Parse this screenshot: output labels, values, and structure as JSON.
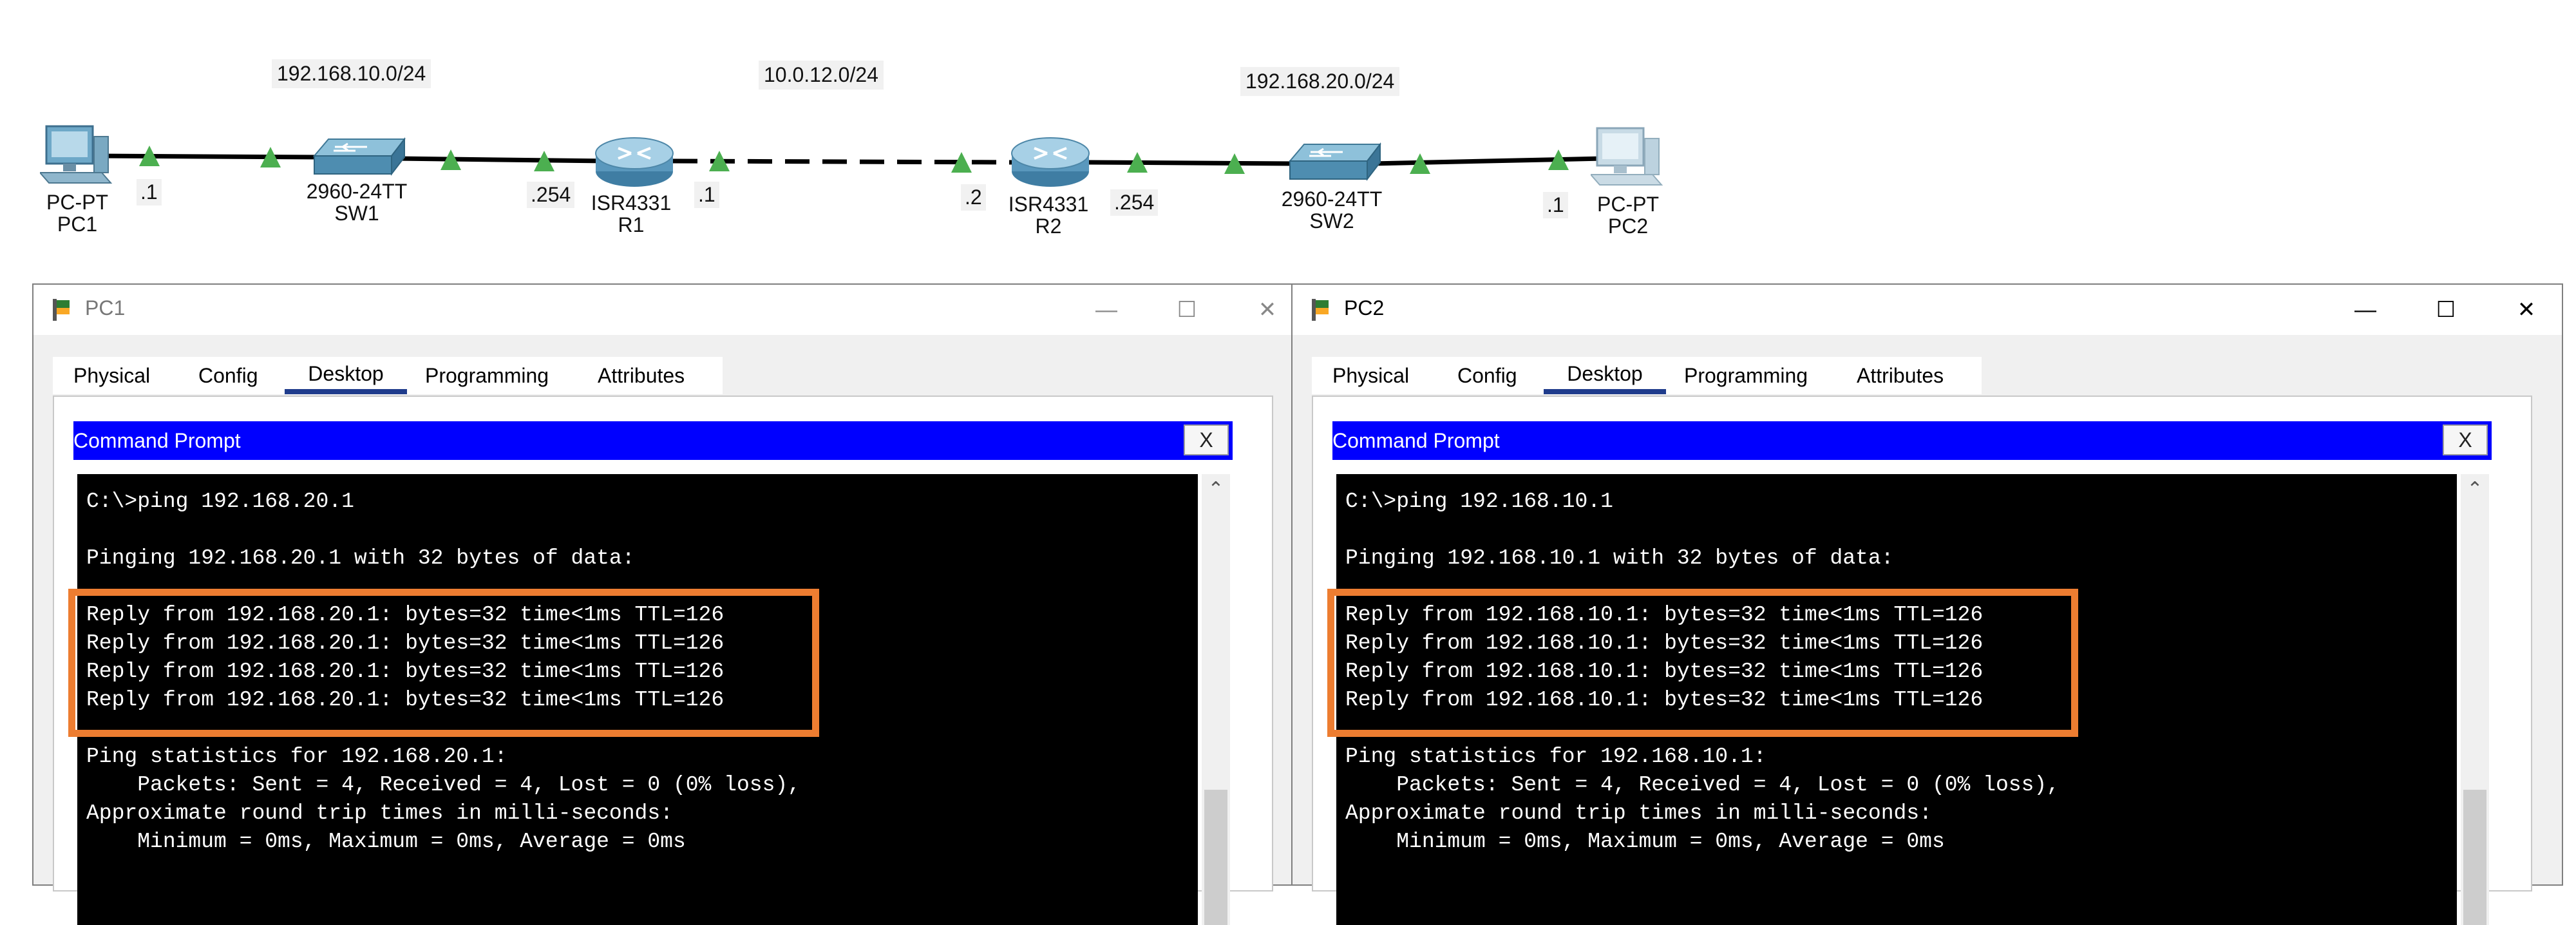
{
  "colors": {
    "accent_highlight": "#ed7d31",
    "command_prompt_bar": "#0000ff",
    "tab_underline": "#1f3c8c",
    "link_green": "#4caf50"
  },
  "topology": {
    "subnets": [
      "192.168.10.0/24",
      "10.0.12.0/24",
      "192.168.20.0/24"
    ],
    "interfaces": [
      ".1",
      ".254",
      ".1",
      ".2",
      ".254",
      ".1"
    ],
    "devices": [
      {
        "name": "PC1",
        "model": "PC-PT",
        "icon": "pc-icon"
      },
      {
        "name": "SW1",
        "model": "2960-24TT",
        "icon": "switch-icon"
      },
      {
        "name": "R1",
        "model": "ISR4331",
        "icon": "router-icon"
      },
      {
        "name": "R2",
        "model": "ISR4331",
        "icon": "router-icon"
      },
      {
        "name": "SW2",
        "model": "2960-24TT",
        "icon": "switch-icon"
      },
      {
        "name": "PC2",
        "model": "PC-PT",
        "icon": "pc-icon"
      }
    ]
  },
  "windows": [
    {
      "title": "PC1",
      "controls": [
        "—",
        "☐",
        "✕"
      ],
      "tabs": [
        "Physical",
        "Config",
        "Desktop",
        "Programming",
        "Attributes"
      ],
      "active_tab": "Desktop",
      "app_title": "Command Prompt",
      "app_close": "X",
      "lines": [
        "C:\\>ping 192.168.20.1",
        "Pinging 192.168.20.1 with 32 bytes of data:",
        "Reply from 192.168.20.1: bytes=32 time<1ms TTL=126",
        "Reply from 192.168.20.1: bytes=32 time<1ms TTL=126",
        "Reply from 192.168.20.1: bytes=32 time<1ms TTL=126",
        "Reply from 192.168.20.1: bytes=32 time<1ms TTL=126",
        "Ping statistics for 192.168.20.1:",
        "    Packets: Sent = 4, Received = 4, Lost = 0 (0% loss),",
        "Approximate round trip times in milli-seconds:",
        "    Minimum = 0ms, Maximum = 0ms, Average = 0ms"
      ]
    },
    {
      "title": "PC2",
      "controls": [
        "—",
        "☐",
        "✕"
      ],
      "tabs": [
        "Physical",
        "Config",
        "Desktop",
        "Programming",
        "Attributes"
      ],
      "active_tab": "Desktop",
      "app_title": "Command Prompt",
      "app_close": "X",
      "lines": [
        "C:\\>ping 192.168.10.1",
        "Pinging 192.168.10.1 with 32 bytes of data:",
        "Reply from 192.168.10.1: bytes=32 time<1ms TTL=126",
        "Reply from 192.168.10.1: bytes=32 time<1ms TTL=126",
        "Reply from 192.168.10.1: bytes=32 time<1ms TTL=126",
        "Reply from 192.168.10.1: bytes=32 time<1ms TTL=126",
        "Ping statistics for 192.168.10.1:",
        "    Packets: Sent = 4, Received = 4, Lost = 0 (0% loss),",
        "Approximate round trip times in milli-seconds:",
        "    Minimum = 0ms, Maximum = 0ms, Average = 0ms"
      ]
    }
  ]
}
